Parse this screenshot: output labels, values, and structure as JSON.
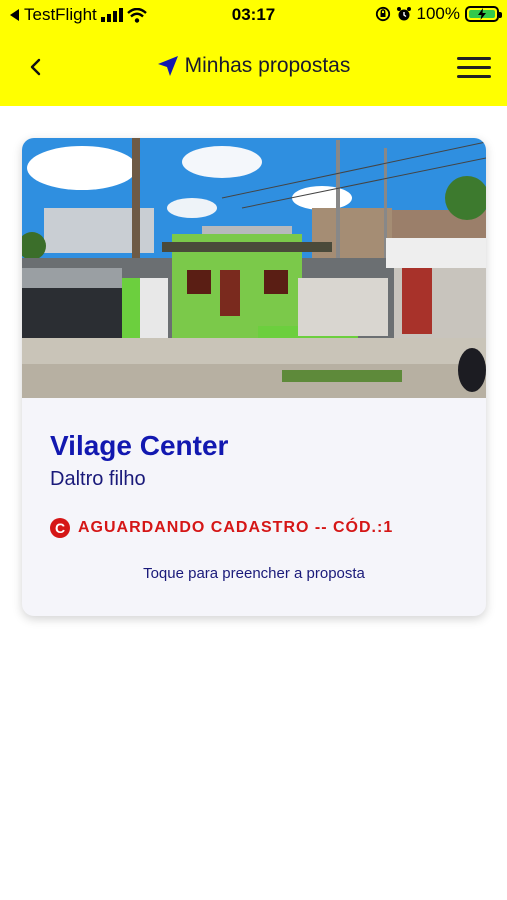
{
  "status_bar": {
    "back_app": "TestFlight",
    "time": "03:17",
    "battery": "100%"
  },
  "navbar": {
    "title": "Minhas propostas"
  },
  "card": {
    "title": "Vilage Center",
    "subtitle": "Daltro filho",
    "status_label": "AGUARDANDO CADASTRO -- CÓD.:1",
    "hint": "Toque para preencher a proposta"
  },
  "colors": {
    "header_bg": "#ffff00",
    "title_blue": "#1218b0",
    "status_red": "#d51616"
  }
}
